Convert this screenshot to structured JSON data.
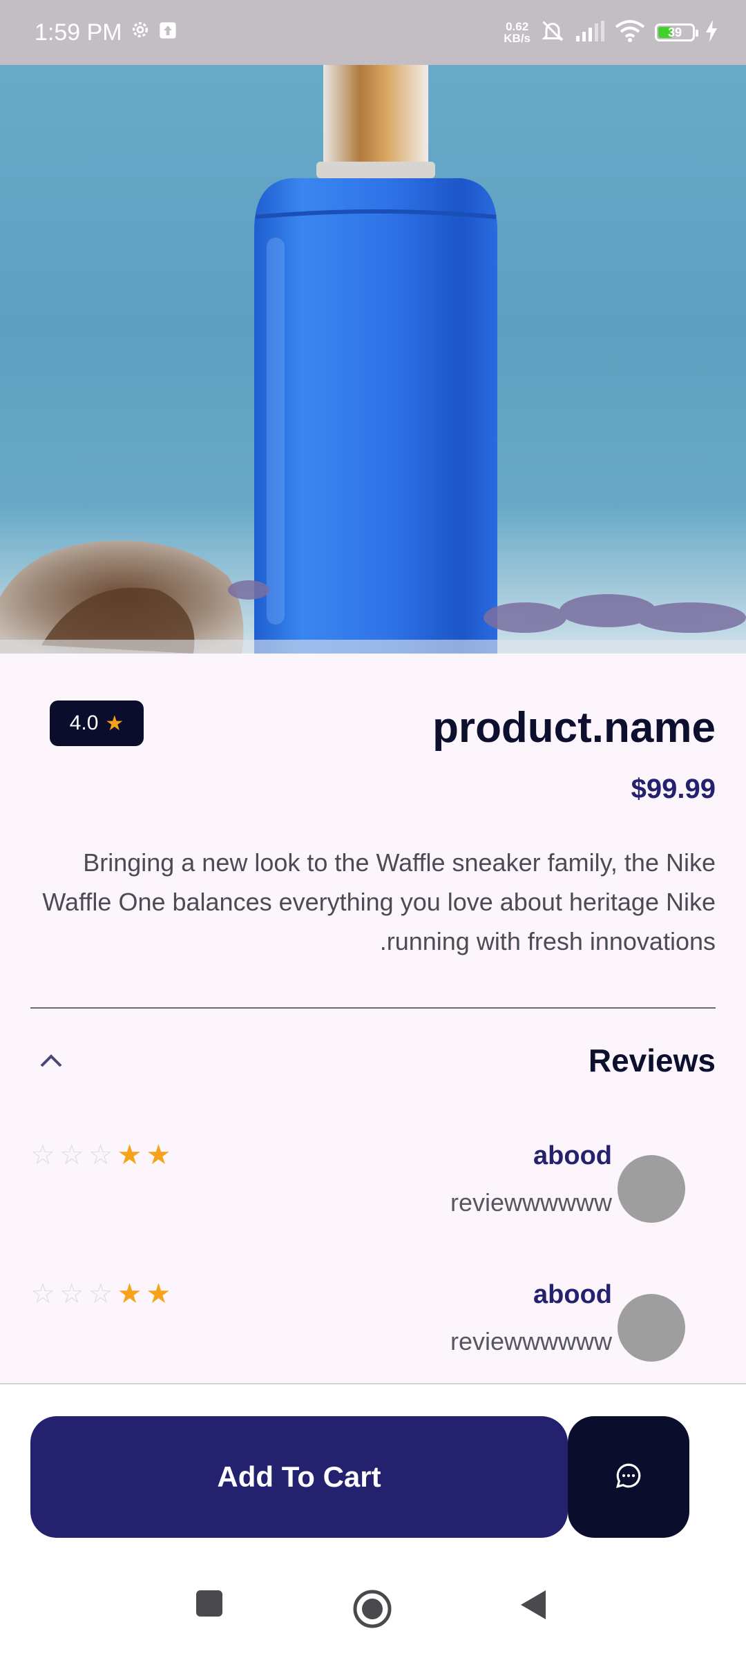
{
  "status_bar": {
    "time": "1:59 PM",
    "net_speed_value": "0.62",
    "net_speed_unit": "KB/s",
    "battery": "39",
    "battery_level": 0.39,
    "icons": [
      "gear-icon",
      "upload-icon",
      "mute-icon",
      "signal-icon",
      "wifi-icon",
      "battery-icon",
      "charging-icon"
    ]
  },
  "hero": {
    "carousel_active_index": 2,
    "carousel_count": 3
  },
  "product": {
    "rating": "4.0",
    "name": "product.name",
    "price": "$99.99",
    "description": "Bringing a new look to the Waffle sneaker family, the Nike Waffle One balances everything you love about heritage Nike running with fresh innovations."
  },
  "reviews": {
    "title": "Reviews",
    "items": [
      {
        "name": "abood",
        "text": "reviewwwwww",
        "stars": 2,
        "max_stars": 5
      },
      {
        "name": "abood",
        "text": "reviewwwwww",
        "stars": 2,
        "max_stars": 5
      }
    ]
  },
  "actions": {
    "add_to_cart": "Add To Cart",
    "chat_icon": "chat-icon"
  },
  "colors": {
    "primary": "#24226e",
    "dark": "#0b0d2c",
    "star": "#f6a31b",
    "background": "#fcf6fc"
  }
}
